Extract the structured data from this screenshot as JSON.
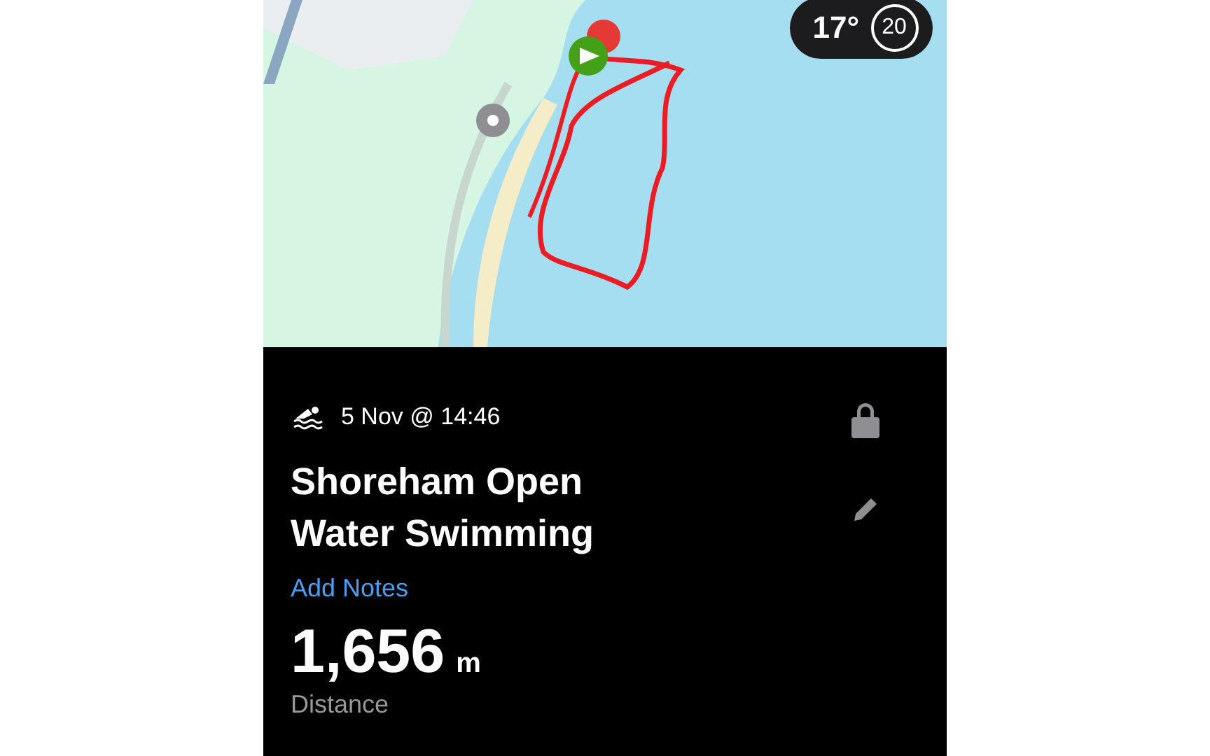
{
  "weather": {
    "temperature": "17°",
    "wind": "20"
  },
  "activity": {
    "date": "5 Nov @ 14:46",
    "title": "Shoreham Open Water Swimming",
    "notes_link": "Add Notes",
    "distance": "1,656",
    "unit": "m",
    "distance_label": "Distance"
  }
}
